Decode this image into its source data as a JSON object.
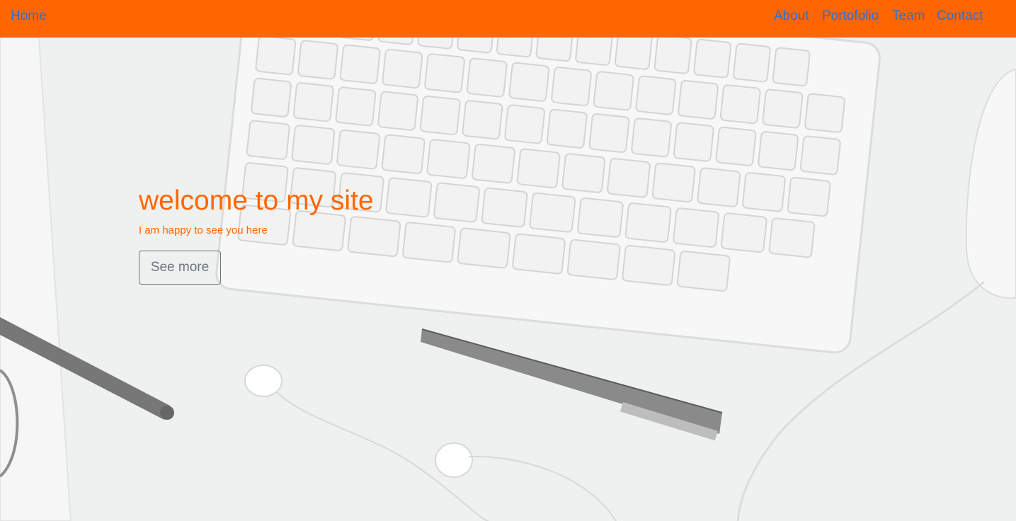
{
  "nav": {
    "home": "Home",
    "links": [
      "About",
      "Portofolio",
      "Team",
      "Contact"
    ]
  },
  "hero": {
    "title": "welcome to my site",
    "subtitle": "I am happy to see you here",
    "button": "See more"
  },
  "colors": {
    "accent": "#ff6600",
    "link": "#2b6fd6",
    "button_border": "#6c757d"
  }
}
